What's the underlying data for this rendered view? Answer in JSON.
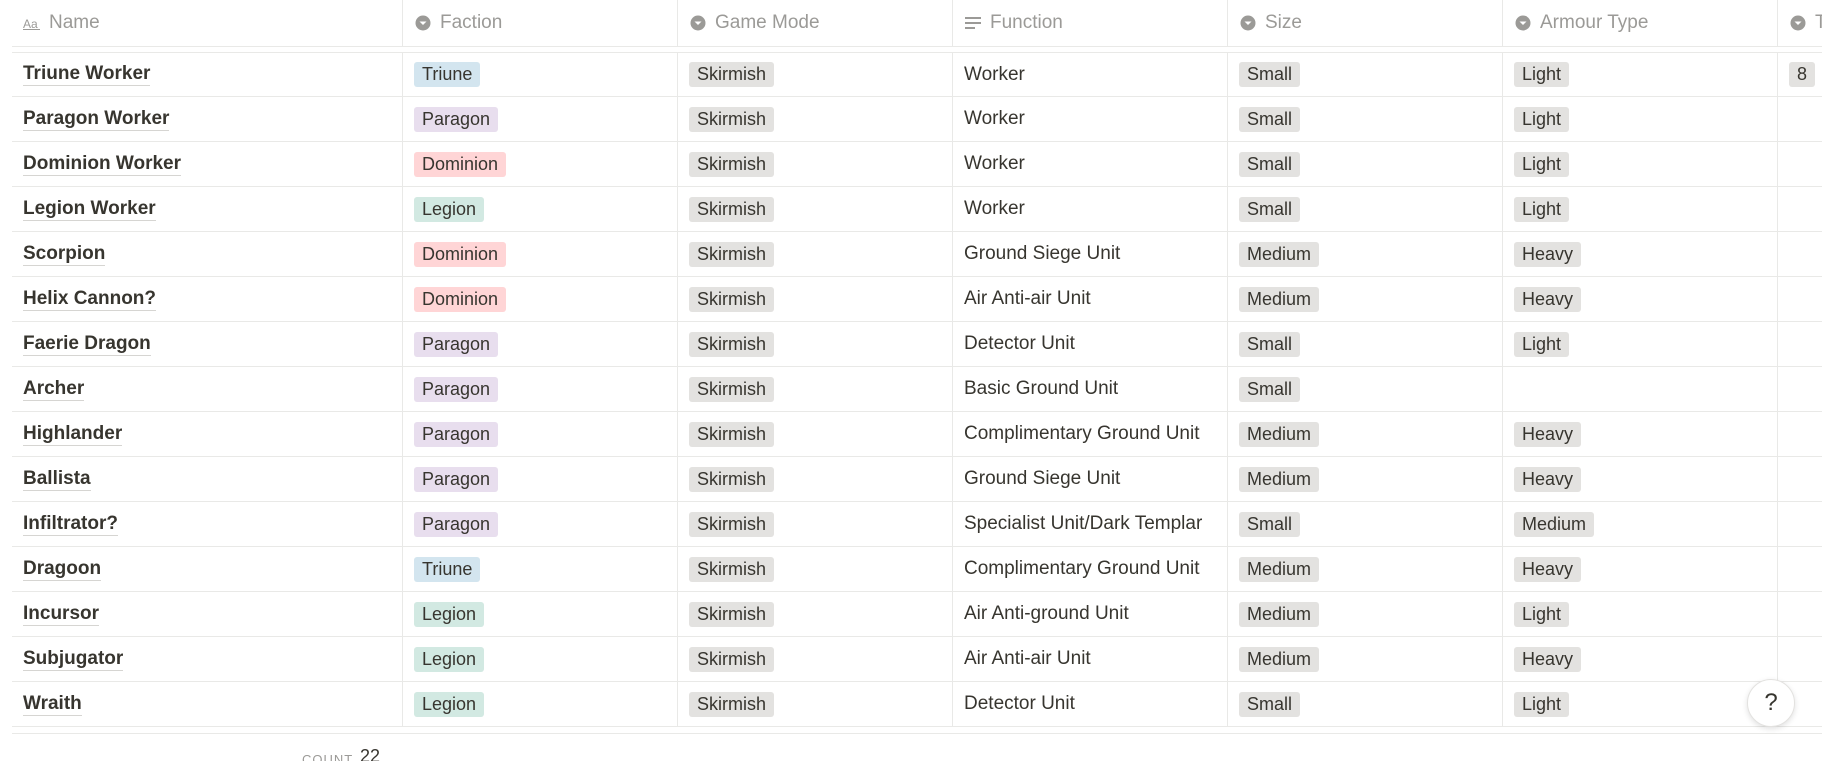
{
  "columns": [
    {
      "label": "Name",
      "icon": "title-icon"
    },
    {
      "label": "Faction",
      "icon": "select-icon"
    },
    {
      "label": "Game Mode",
      "icon": "select-icon"
    },
    {
      "label": "Function",
      "icon": "text-lines-icon"
    },
    {
      "label": "Size",
      "icon": "select-icon"
    },
    {
      "label": "Armour Type",
      "icon": "select-icon"
    },
    {
      "label": "Tr",
      "icon": "select-icon"
    }
  ],
  "colors": {
    "Triune": "#d3e5ef",
    "Paragon": "#e8deee",
    "Dominion": "#ffd5d6",
    "Legion": "#d2e9e2",
    "neutral": "#e3e2e0"
  },
  "rows": [
    {
      "name": "Triune Worker",
      "faction": "Triune",
      "mode": "Skirmish",
      "function": "Worker",
      "size": "Small",
      "armour": "Light",
      "extra": "8"
    },
    {
      "name": "Paragon Worker",
      "faction": "Paragon",
      "mode": "Skirmish",
      "function": "Worker",
      "size": "Small",
      "armour": "Light",
      "extra": ""
    },
    {
      "name": "Dominion Worker",
      "faction": "Dominion",
      "mode": "Skirmish",
      "function": "Worker",
      "size": "Small",
      "armour": "Light",
      "extra": ""
    },
    {
      "name": "Legion Worker",
      "faction": "Legion",
      "mode": "Skirmish",
      "function": "Worker",
      "size": "Small",
      "armour": "Light",
      "extra": ""
    },
    {
      "name": "Scorpion",
      "faction": "Dominion",
      "mode": "Skirmish",
      "function": "Ground Siege Unit",
      "size": "Medium",
      "armour": "Heavy",
      "extra": ""
    },
    {
      "name": "Helix Cannon?",
      "faction": "Dominion",
      "mode": "Skirmish",
      "function": "Air Anti-air Unit",
      "size": "Medium",
      "armour": "Heavy",
      "extra": ""
    },
    {
      "name": "Faerie Dragon",
      "faction": "Paragon",
      "mode": "Skirmish",
      "function": "Detector Unit",
      "size": "Small",
      "armour": "Light",
      "extra": ""
    },
    {
      "name": "Archer",
      "faction": "Paragon",
      "mode": "Skirmish",
      "function": "Basic Ground Unit",
      "size": "Small",
      "armour": "",
      "extra": ""
    },
    {
      "name": "Highlander",
      "faction": "Paragon",
      "mode": "Skirmish",
      "function": "Complimentary Ground Unit",
      "size": "Medium",
      "armour": "Heavy",
      "extra": ""
    },
    {
      "name": "Ballista",
      "faction": "Paragon",
      "mode": "Skirmish",
      "function": "Ground Siege Unit",
      "size": "Medium",
      "armour": "Heavy",
      "extra": ""
    },
    {
      "name": "Infiltrator?",
      "faction": "Paragon",
      "mode": "Skirmish",
      "function": "Specialist Unit/Dark Templar",
      "size": "Small",
      "armour": "Medium",
      "extra": ""
    },
    {
      "name": "Dragoon",
      "faction": "Triune",
      "mode": "Skirmish",
      "function": "Complimentary Ground Unit",
      "size": "Medium",
      "armour": "Heavy",
      "extra": ""
    },
    {
      "name": "Incursor",
      "faction": "Legion",
      "mode": "Skirmish",
      "function": "Air Anti-ground Unit",
      "size": "Medium",
      "armour": "Light",
      "extra": ""
    },
    {
      "name": "Subjugator",
      "faction": "Legion",
      "mode": "Skirmish",
      "function": "Air Anti-air Unit",
      "size": "Medium",
      "armour": "Heavy",
      "extra": ""
    },
    {
      "name": "Wraith",
      "faction": "Legion",
      "mode": "Skirmish",
      "function": "Detector Unit",
      "size": "Small",
      "armour": "Light",
      "extra": ""
    }
  ],
  "footer": {
    "count_label": "COUNT",
    "count_value": "22"
  },
  "help": {
    "label": "?"
  }
}
